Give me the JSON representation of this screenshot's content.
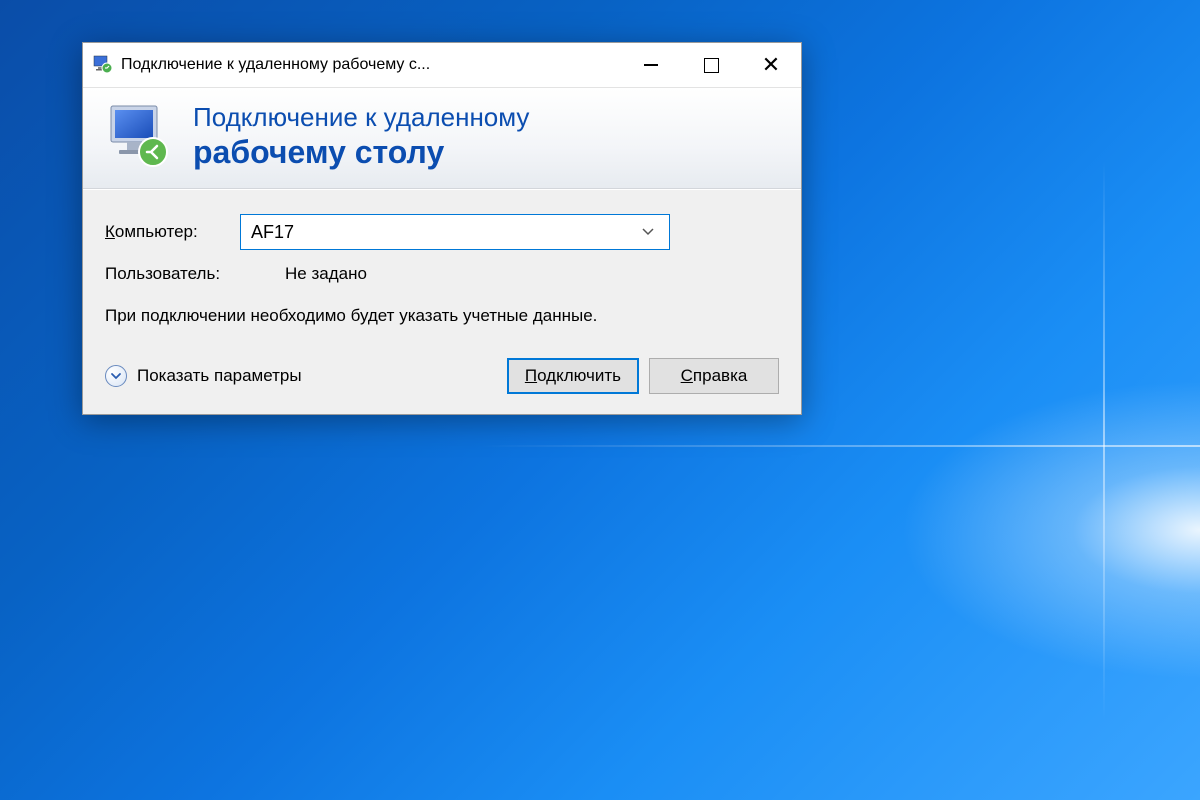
{
  "window": {
    "title": "Подключение к удаленному рабочему с..."
  },
  "header": {
    "line1": "Подключение к удаленному",
    "line2": "рабочему столу"
  },
  "form": {
    "computer_label": "Компьютер:",
    "computer_accel": "К",
    "computer_label_rest": "омпьютер:",
    "computer_value": "AF17",
    "user_label": "Пользователь:",
    "user_value": "Не задано",
    "info_text": "При подключении необходимо будет указать учетные данные."
  },
  "footer": {
    "show_options": "Показать параметры",
    "connect_accel": "П",
    "connect_rest": "одключить",
    "help_accel": "С",
    "help_rest": "правка"
  }
}
